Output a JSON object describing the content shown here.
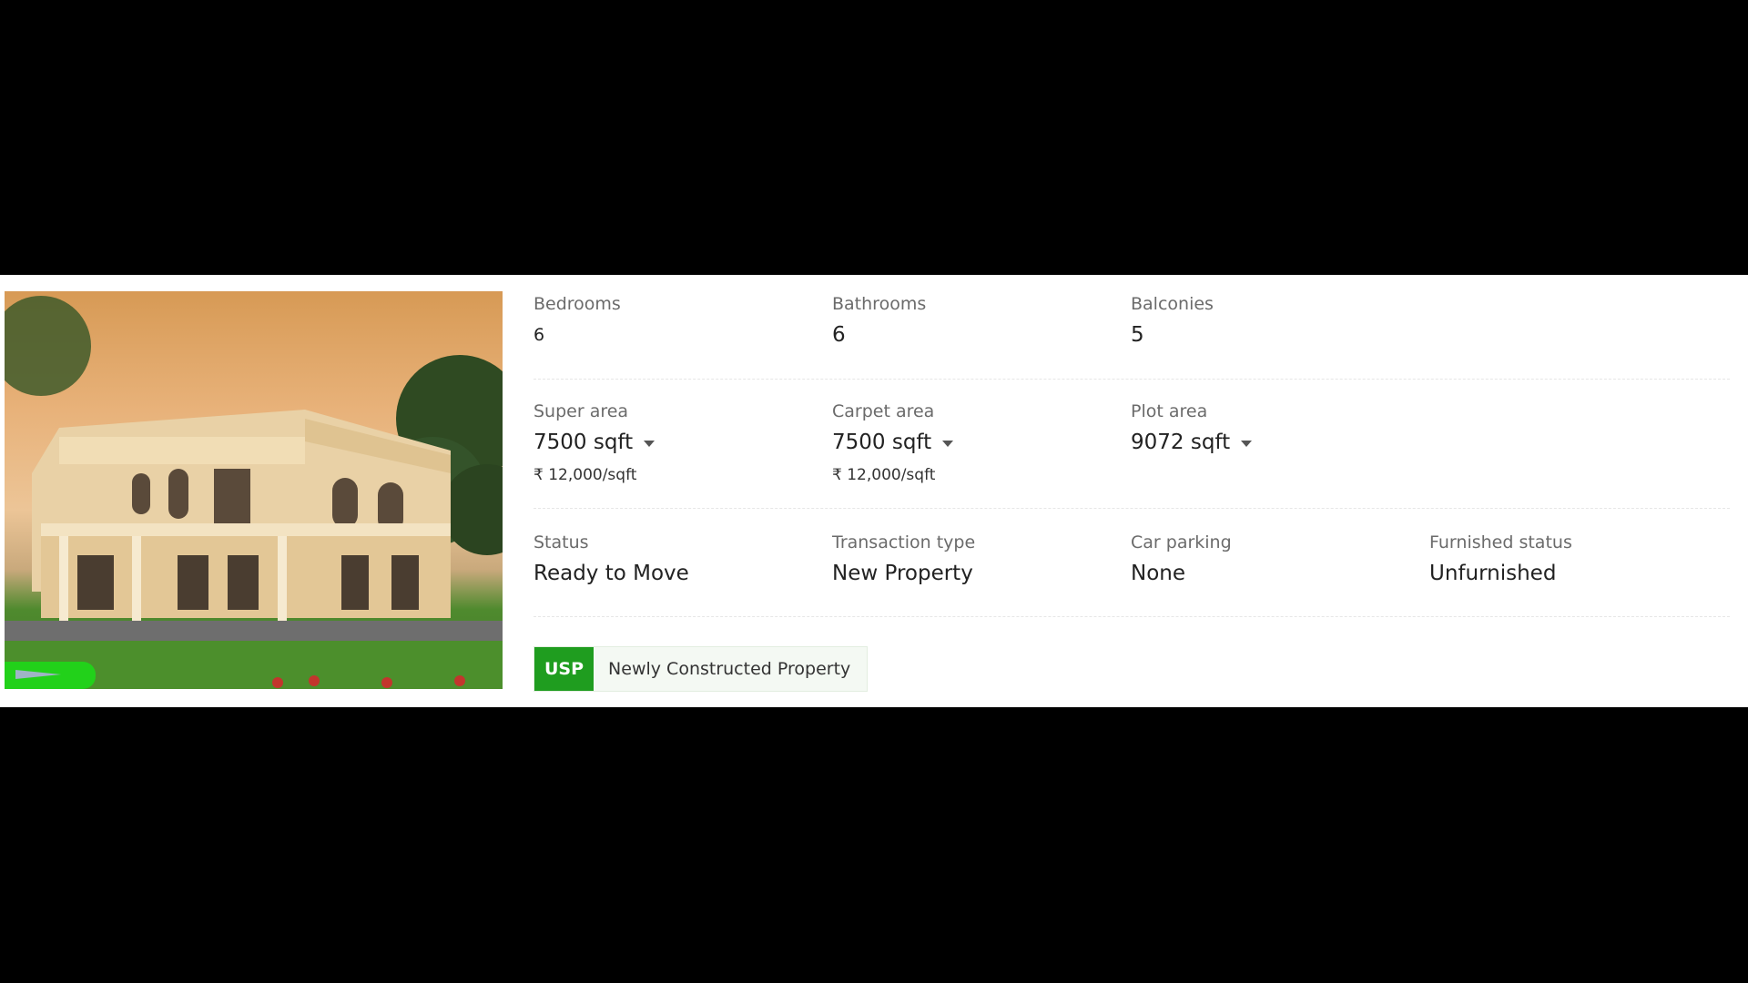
{
  "listing": {
    "photo_alt": "property-photo",
    "rows": [
      [
        {
          "label": "Bedrooms",
          "value": "6"
        },
        {
          "label": "Bathrooms",
          "value": "6"
        },
        {
          "label": "Balconies",
          "value": "5"
        }
      ],
      [
        {
          "label": "Super area",
          "value": "7500 sqft",
          "rate": "₹ 12,000/sqft"
        },
        {
          "label": "Carpet area",
          "value": "7500 sqft",
          "rate": "₹ 12,000/sqft"
        },
        {
          "label": "Plot area",
          "value": "9072 sqft"
        }
      ],
      [
        {
          "label": "Status",
          "value": "Ready to Move"
        },
        {
          "label": "Transaction type",
          "value": "New Property"
        },
        {
          "label": "Car parking",
          "value": "None"
        },
        {
          "label": "Furnished status",
          "value": "Unfurnished"
        }
      ]
    ],
    "usp": {
      "badge": "USP",
      "text": "Newly Constructed Property"
    }
  },
  "colors": {
    "usp_green": "#1f9d1f",
    "label_gray": "#6b6b6b",
    "value_dark": "#222222"
  }
}
